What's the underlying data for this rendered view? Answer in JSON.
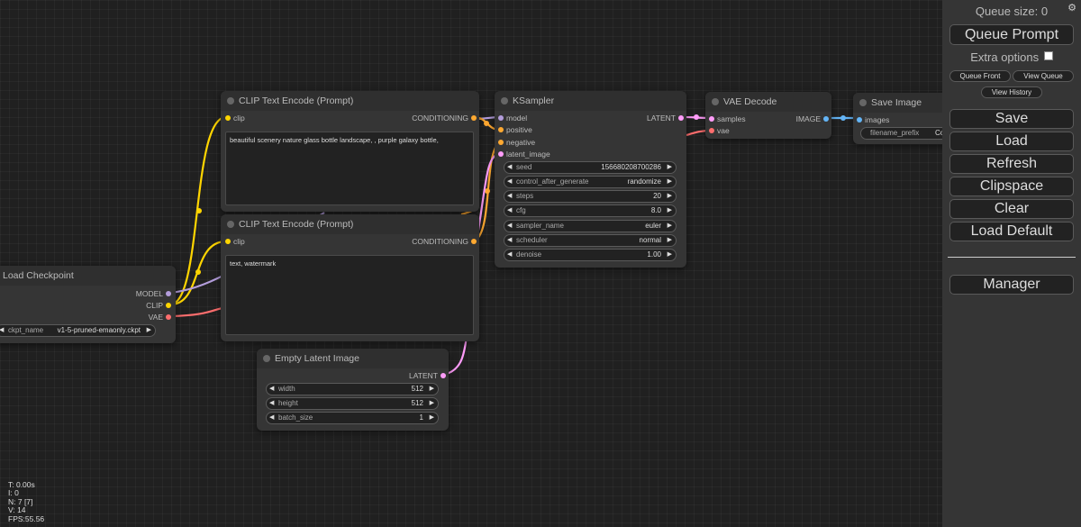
{
  "nodes": {
    "load_checkpoint": {
      "title": "Load Checkpoint",
      "outputs": [
        "MODEL",
        "CLIP",
        "VAE"
      ],
      "ckpt_label": "ckpt_name",
      "ckpt_value": "v1-5-pruned-emaonly.ckpt"
    },
    "clip_pos": {
      "title": "CLIP Text Encode (Prompt)",
      "input": "clip",
      "output": "CONDITIONING",
      "text": "beautiful scenery nature glass bottle landscape, , purple galaxy bottle,"
    },
    "clip_neg": {
      "title": "CLIP Text Encode (Prompt)",
      "input": "clip",
      "output": "CONDITIONING",
      "text": "text, watermark"
    },
    "empty_latent": {
      "title": "Empty Latent Image",
      "output": "LATENT",
      "widgets": [
        {
          "label": "width",
          "value": "512"
        },
        {
          "label": "height",
          "value": "512"
        },
        {
          "label": "batch_size",
          "value": "1"
        }
      ]
    },
    "ksampler": {
      "title": "KSampler",
      "inputs": [
        "model",
        "positive",
        "negative",
        "latent_image"
      ],
      "output": "LATENT",
      "widgets": [
        {
          "label": "seed",
          "value": "156680208700286"
        },
        {
          "label": "control_after_generate",
          "value": "randomize"
        },
        {
          "label": "steps",
          "value": "20"
        },
        {
          "label": "cfg",
          "value": "8.0"
        },
        {
          "label": "sampler_name",
          "value": "euler"
        },
        {
          "label": "scheduler",
          "value": "normal"
        },
        {
          "label": "denoise",
          "value": "1.00"
        }
      ]
    },
    "vae_decode": {
      "title": "VAE Decode",
      "inputs": [
        "samples",
        "vae"
      ],
      "output": "IMAGE"
    },
    "save_image": {
      "title": "Save Image",
      "input": "images",
      "prefix_label": "filename_prefix",
      "prefix_value": "Co"
    }
  },
  "sidebar": {
    "queue_size": "Queue size: 0",
    "queue_prompt": "Queue Prompt",
    "extra_options": "Extra options",
    "queue_front": "Queue Front",
    "view_queue": "View Queue",
    "view_history": "View History",
    "buttons": [
      "Save",
      "Load",
      "Refresh",
      "Clipspace",
      "Clear",
      "Load Default"
    ],
    "manager": "Manager",
    "settings_icon": "gear-icon"
  },
  "stats": [
    "T: 0.00s",
    "I: 0",
    "N: 7 [7]",
    "V: 14",
    "FPS:55.56"
  ],
  "colors": {
    "model": "#b39ddb",
    "clip": "#ffd500",
    "vae": "#ff6e6e",
    "conditioning": "#ffa931",
    "latent": "#ff9cf9",
    "image": "#64b5f6",
    "canvas": "#202020",
    "node": "#353535"
  }
}
